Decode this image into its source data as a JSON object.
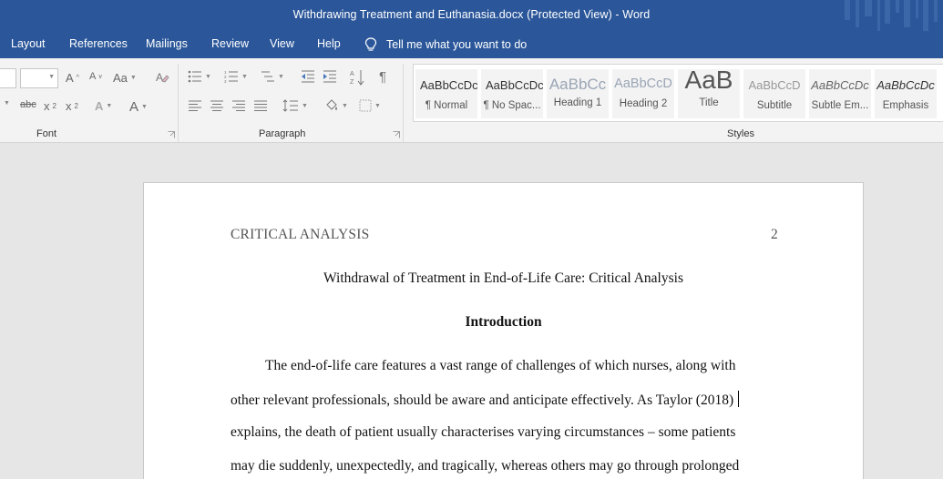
{
  "window": {
    "title": "Withdrawing Treatment and Euthanasia.docx (Protected View)  -  Word"
  },
  "menu": {
    "tabs": [
      "Layout",
      "References",
      "Mailings",
      "Review",
      "View",
      "Help"
    ],
    "tell_me": "Tell me what you want to do"
  },
  "ribbon": {
    "groups": {
      "font": "Font",
      "paragraph": "Paragraph",
      "styles": "Styles"
    },
    "font_tools": {
      "grow": "A",
      "shrink": "A",
      "case": "Aa",
      "strike": "abc",
      "sub": "x",
      "sup": "x",
      "effects": "A",
      "color": "A"
    },
    "styles": [
      {
        "sample": "AaBbCcDc",
        "name": "¶ Normal"
      },
      {
        "sample": "AaBbCcDc",
        "name": "¶ No Spac..."
      },
      {
        "sample": "AaBbCc",
        "name": "Heading 1"
      },
      {
        "sample": "AaBbCcD",
        "name": "Heading 2"
      },
      {
        "sample": "AaB",
        "name": "Title"
      },
      {
        "sample": "AaBbCcD",
        "name": "Subtitle"
      },
      {
        "sample": "AaBbCcDc",
        "name": "Subtle Em..."
      },
      {
        "sample": "AaBbCcDc",
        "name": "Emphasis"
      }
    ]
  },
  "document": {
    "header_left": "CRITICAL ANALYSIS",
    "page_number": "2",
    "title": "Withdrawal of Treatment in End-of-Life Care: Critical Analysis",
    "heading": "Introduction",
    "lines": [
      "The end-of-life care features a vast range of challenges of which nurses, along with",
      "other relevant professionals, should be aware and anticipate effectively. As Taylor (2018)",
      "explains, the death of patient usually characterises varying circumstances – some patients",
      "may die suddenly, unexpectedly, and tragically, whereas others may go through prolonged"
    ]
  }
}
